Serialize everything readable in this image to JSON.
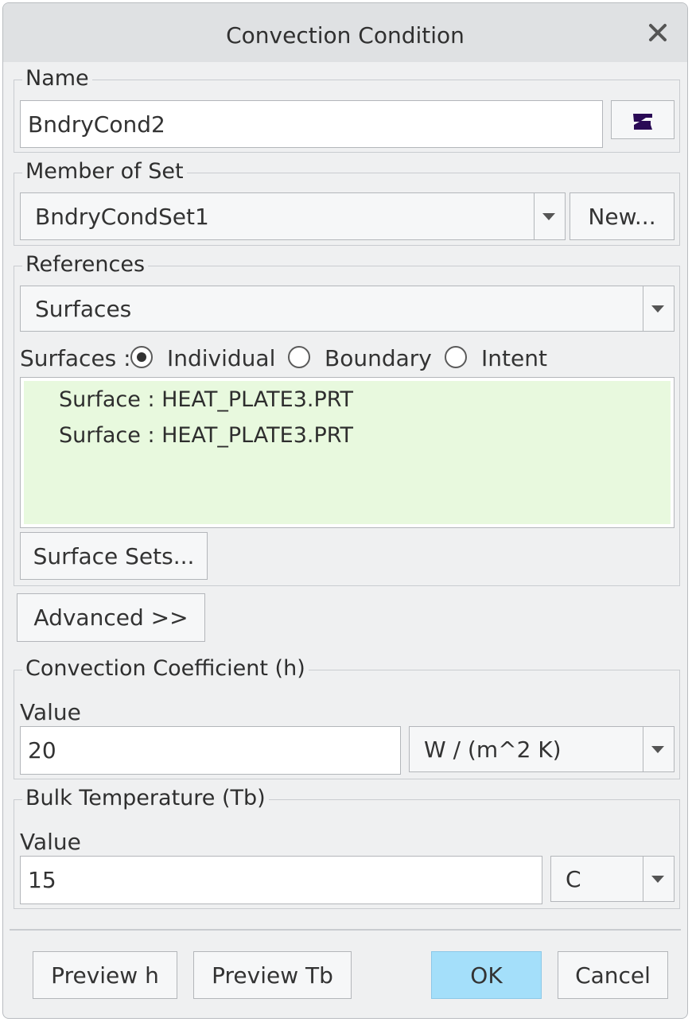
{
  "dialog": {
    "title": "Convection Condition",
    "close_icon": "close-icon"
  },
  "name_group": {
    "legend": "Name",
    "value": "BndryCond2",
    "color_button_icon": "color-swatch-icon",
    "swatch_color": "#2a0a55"
  },
  "member_group": {
    "legend": "Member of Set",
    "selected": "BndryCondSet1",
    "new_button": "New..."
  },
  "references_group": {
    "legend": "References",
    "type_selected": "Surfaces",
    "surfaces_label": "Surfaces :",
    "radio_options": [
      {
        "label": "Individual",
        "selected": true
      },
      {
        "label": "Boundary",
        "selected": false
      },
      {
        "label": "Intent",
        "selected": false
      }
    ],
    "list_items": [
      "Surface : HEAT_PLATE3.PRT",
      "Surface : HEAT_PLATE3.PRT"
    ],
    "list_bg_color": "#e8f9de",
    "surface_sets_button": "Surface Sets..."
  },
  "advanced_button": "Advanced >>",
  "convection_group": {
    "legend": "Convection Coefficient (h)",
    "value_label": "Value",
    "value": "20",
    "unit": "W / (m^2 K)"
  },
  "bulk_group": {
    "legend": "Bulk Temperature (Tb)",
    "value_label": "Value",
    "value": "15",
    "unit": "C"
  },
  "footer": {
    "preview_h": "Preview h",
    "preview_tb": "Preview Tb",
    "ok": "OK",
    "cancel": "Cancel",
    "ok_color": "#a4dffa"
  }
}
